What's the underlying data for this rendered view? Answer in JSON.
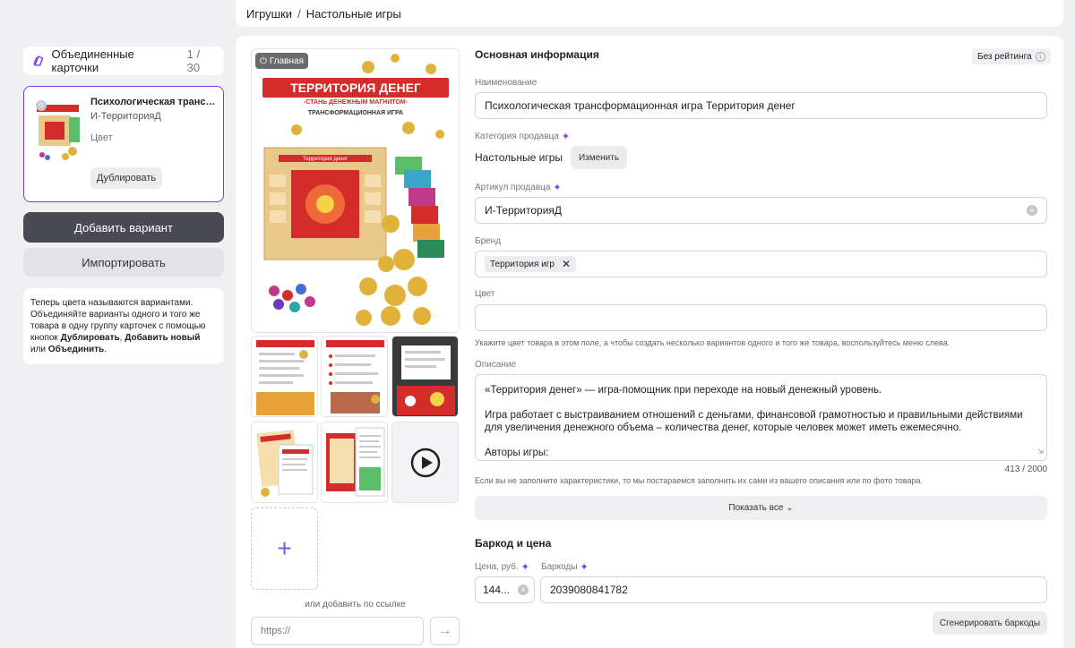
{
  "breadcrumb": {
    "items": [
      "Игрушки",
      "Настольные игры"
    ],
    "separator": "/"
  },
  "left_panel": {
    "merged_title": "Объединенные карточки",
    "merged_count": "1 / 30",
    "card": {
      "title": "Психологическая трансформационная игра Территория денег",
      "sku": "И-ТерриторияД",
      "color_label": "Цвет",
      "duplicate_label": "Дублировать",
      "index": "0"
    },
    "add_variant_label": "Добавить вариант",
    "import_label": "Импортировать",
    "note": {
      "part1": "Теперь цвета называются вариантами. Объединяйте варианты одного и того же товара в одну группу карточек с помощью кнопок ",
      "duplicate": "Дублировать",
      "comma": ", ",
      "add_new": "Добавить новый",
      "or": " или ",
      "merge": "Объединить",
      "dot": "."
    }
  },
  "media": {
    "main_badge": "Главная",
    "poster_title": "ТЕРРИТОРИЯ ДЕНЕГ",
    "poster_subtitle": "-СТАНЬ ДЕНЕЖНЫМ МАГНИТОМ-",
    "poster_tagline": "ТРАНСФОРМАЦИОННАЯ ИГРА",
    "board_title": "Территория денег",
    "or_link_label": "или добавить по ссылке",
    "url_placeholder": "https://"
  },
  "basic_info": {
    "title": "Основная информация",
    "rating": "Без рейтинга",
    "name_label": "Наименование",
    "name_value": "Психологическая трансформационная игра Территория денег",
    "category_label": "Категория продавца",
    "category_value": "Настольные игры",
    "change_label": "Изменить",
    "sku_label": "Артикул продавца",
    "sku_value": "И-ТерриторияД",
    "brand_label": "Бренд",
    "brand_value": "Территория игр",
    "color_label": "Цвет",
    "color_hint": "Укажите цвет товара в этом поле, а чтобы создать несколько вариантов одного и того же товара, воспользуйтесь меню слева.",
    "description_label": "Описание",
    "description_p1": "«Территория денег» — игра-помощник при переходе на новый денежный уровень.",
    "description_p2": "Игра работает с выстраиванием отношений с деньгами, финансовой грамотностью и правильными действиями для увеличения денежного объема – количества денег, которые человек может иметь ежемесячно.",
    "description_p3": "Авторы игры:",
    "description_counter": "413 / 2000",
    "characteristics_hint": "Если вы не заполните характеристики, то мы постараемся заполнить их сами из вашего описания или по фото товара.",
    "show_all_label": "Показать все"
  },
  "barcode_price": {
    "title": "Баркод и цена",
    "price_label": "Цена, руб.",
    "price_value": "144...",
    "barcodes_label": "Баркоды",
    "barcode_value": "2039080841782",
    "generate_label": "Сгенерировать баркоды"
  },
  "colors": {
    "accent": "#7c3aed",
    "dark_button": "#4a4a55",
    "poster_red": "#d42b2b",
    "coin_gold": "#e0b23a"
  }
}
